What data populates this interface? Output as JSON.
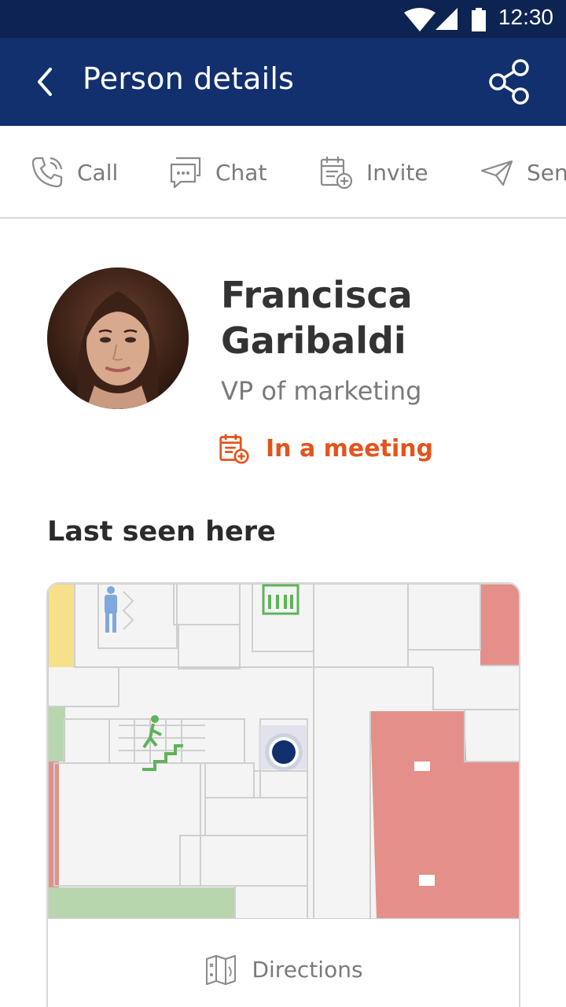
{
  "status_bar": {
    "time": "12:30"
  },
  "app_bar": {
    "title": "Person details"
  },
  "actions": [
    {
      "label": "Call",
      "icon": "phone-icon"
    },
    {
      "label": "Chat",
      "icon": "chat-icon"
    },
    {
      "label": "Invite",
      "icon": "calendar-add-icon"
    },
    {
      "label": "Sen",
      "icon": "send-icon"
    }
  ],
  "person": {
    "first_name": "Francisca",
    "last_name": "Garibaldi",
    "role": "VP of marketing",
    "status": "In a meeting"
  },
  "location": {
    "section_title": "Last seen here",
    "directions_label": "Directions"
  },
  "colors": {
    "status_bar": "#0d2351",
    "app_bar": "#122f6e",
    "status_accent": "#e3541c",
    "room_occupied": "#e58f8a",
    "room_free": "#b7d6ad",
    "room_other": "#f7e08a",
    "location_dot": "#122f6e"
  }
}
